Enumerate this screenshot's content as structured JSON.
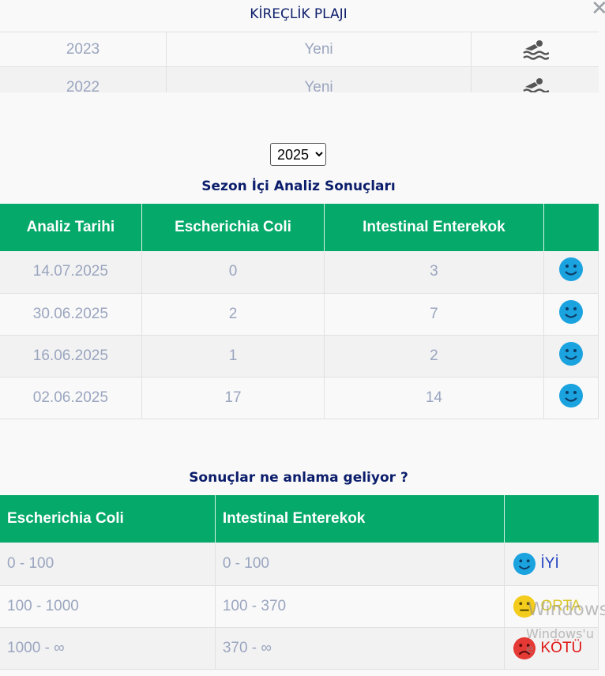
{
  "modal": {
    "title": "KİREÇLİK PLAJI",
    "close_glyph": "✕"
  },
  "history": {
    "rows": [
      {
        "year": "2023",
        "status": "Yeni",
        "icon": "swimmer-icon"
      },
      {
        "year": "2022",
        "status": "Yeni",
        "icon": "swimmer-icon"
      }
    ]
  },
  "year_select": {
    "selected": "2025",
    "options": [
      "2025"
    ]
  },
  "analysis": {
    "title": "Sezon İçi Analiz Sonuçları",
    "headers": [
      "Analiz Tarihi",
      "Escherichia Coli",
      "Intestinal Enterekok",
      ""
    ],
    "rows": [
      {
        "date": "14.07.2025",
        "ecoli": "0",
        "entero": "3",
        "status": "good"
      },
      {
        "date": "30.06.2025",
        "ecoli": "2",
        "entero": "7",
        "status": "good"
      },
      {
        "date": "16.06.2025",
        "ecoli": "1",
        "entero": "2",
        "status": "good"
      },
      {
        "date": "02.06.2025",
        "ecoli": "17",
        "entero": "14",
        "status": "good"
      }
    ]
  },
  "legend": {
    "title": "Sonuçlar ne anlama geliyor ?",
    "headers": [
      "Escherichia Coli",
      "Intestinal Enterekok",
      ""
    ],
    "rows": [
      {
        "ecoli": "0 - 100",
        "entero": "0 - 100",
        "label": "İYİ",
        "level": "good"
      },
      {
        "ecoli": "100 - 1000",
        "entero": "100 - 370",
        "label": "ORTA",
        "level": "mid"
      },
      {
        "ecoli": "1000 - ∞",
        "entero": "370 - ∞",
        "label": "KÖTÜ",
        "level": "bad"
      }
    ]
  },
  "colors": {
    "header_green": "#05a96a",
    "title_navy": "#0b1d6b",
    "good": "#1ba3e0",
    "mid": "#f3cc1d",
    "bad": "#e53935"
  },
  "watermark": {
    "line1": "Windows",
    "line2": "Windows'u e"
  }
}
